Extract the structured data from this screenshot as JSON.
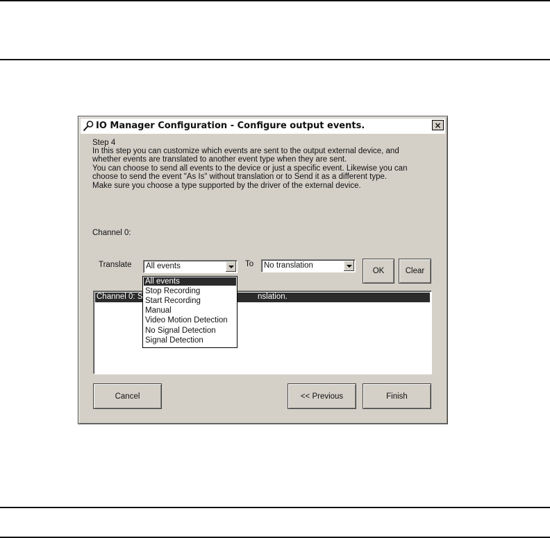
{
  "dialog": {
    "title": "IO Manager Configuration - Configure output events.",
    "close_glyph": "×",
    "step": "Step 4",
    "description_lines": [
      "In this step you can customize which events are sent to the output external device, and",
      "whether events are translated to another event type when they are sent.",
      "You can choose to send all events to the device or just a specific event. Likewise you can",
      "choose to send the event \"As Is\" without translation or to Send it as a different type.",
      "Make sure you choose a type supported by the driver of the external device."
    ],
    "channel_label": "Channel 0:",
    "translate_label": "Translate",
    "translate_value": "All events",
    "to_label": "To",
    "to_value": "No translation",
    "ok_label": "OK",
    "clear_label": "Clear",
    "list_row_left": "Channel 0:  S",
    "list_row_right": "nslation.",
    "dropdown_options": [
      "All events",
      "Stop Recording",
      "Start Recording",
      "Manual",
      "Video Motion Detection",
      "No Signal Detection",
      "Signal Detection"
    ],
    "dropdown_selected": "All events",
    "cancel_label": "Cancel",
    "previous_label": "<< Previous",
    "finish_label": "Finish"
  },
  "icons": {
    "title_icon": "wrench-icon",
    "dropdown_arrow": "chevron-down-icon"
  },
  "colors": {
    "dialog_face": "#d4d0c8",
    "selection": "#2b2b2b",
    "page_rules": "#111111"
  }
}
